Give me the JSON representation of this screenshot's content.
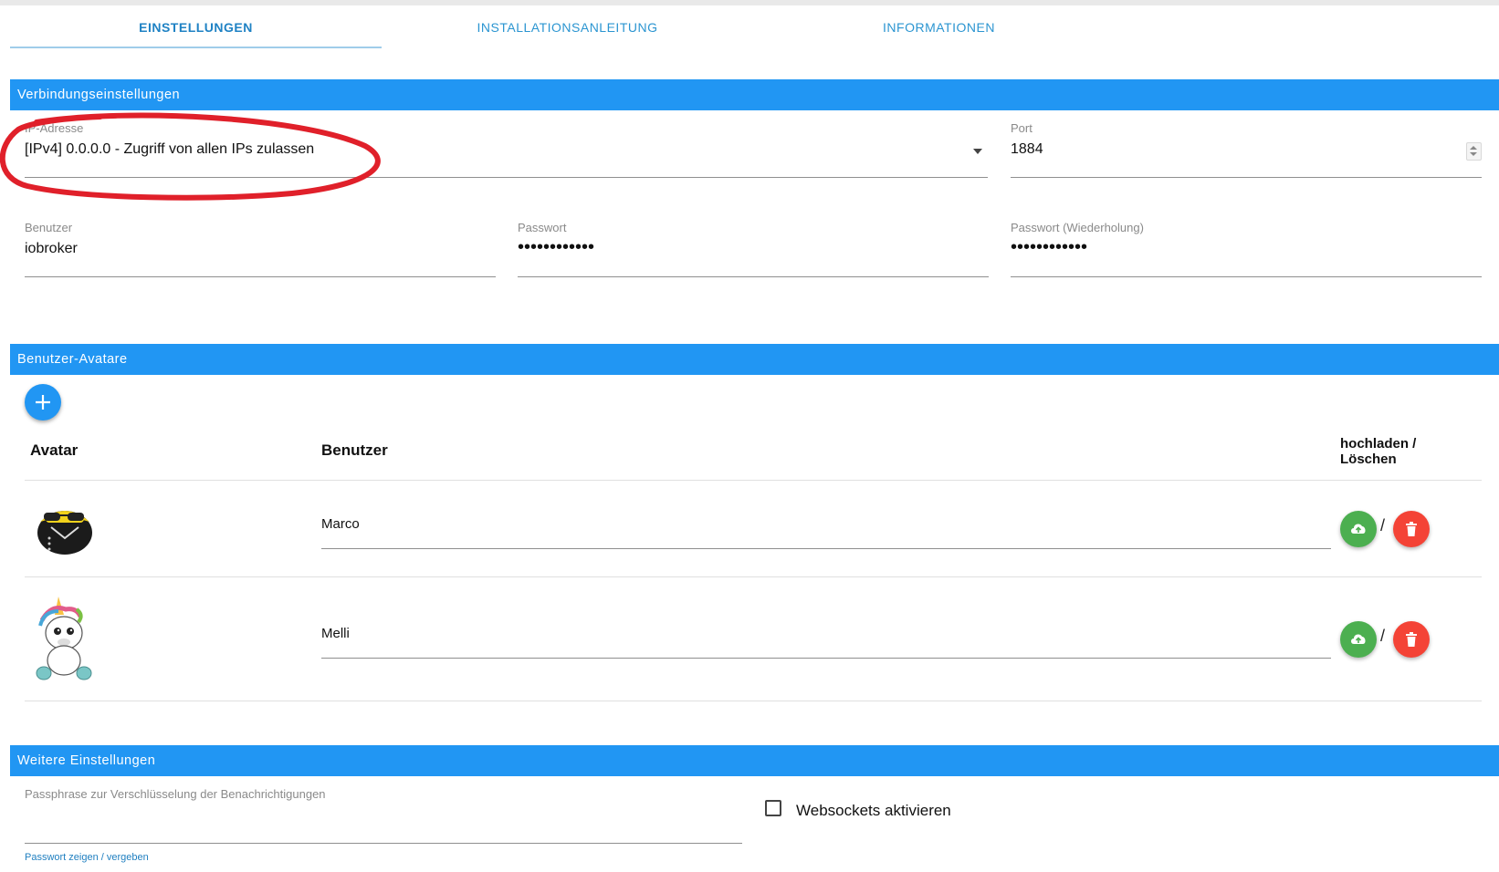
{
  "tabs": [
    {
      "label": "EINSTELLUNGEN",
      "active": true
    },
    {
      "label": "INSTALLATIONSANLEITUNG",
      "active": false
    },
    {
      "label": "INFORMATIONEN",
      "active": false
    }
  ],
  "connection": {
    "title": "Verbindungseinstellungen",
    "ip": {
      "label": "IP-Adresse",
      "value": "[IPv4] 0.0.0.0 - Zugriff von allen IPs zulassen"
    },
    "port": {
      "label": "Port",
      "value": "1884"
    },
    "user": {
      "label": "Benutzer",
      "value": "iobroker"
    },
    "password": {
      "label": "Passwort",
      "value": "••••••••••••"
    },
    "password_repeat": {
      "label": "Passwort (Wiederholung)",
      "value": "••••••••••••"
    }
  },
  "avatars": {
    "title": "Benutzer-Avatare",
    "columns": {
      "avatar": "Avatar",
      "user": "Benutzer",
      "actions": "hochladen / Löschen"
    },
    "rows": [
      {
        "user": "Marco",
        "avatar_icon": "sunglasses-avatar-icon"
      },
      {
        "user": "Melli",
        "avatar_icon": "unicorn-avatar-icon"
      }
    ],
    "separator": "/"
  },
  "further": {
    "title": "Weitere Einstellungen",
    "passphrase_label": "Passphrase zur Verschlüsselung der Benachrichtigungen",
    "passphrase_value": "",
    "password_link": "Passwort zeigen / vergeben",
    "websockets_label": "Websockets aktivieren",
    "websockets_checked": false
  },
  "colors": {
    "primary": "#2196f3",
    "upload": "#4caf50",
    "delete": "#f44336",
    "highlight": "#e0202a"
  }
}
